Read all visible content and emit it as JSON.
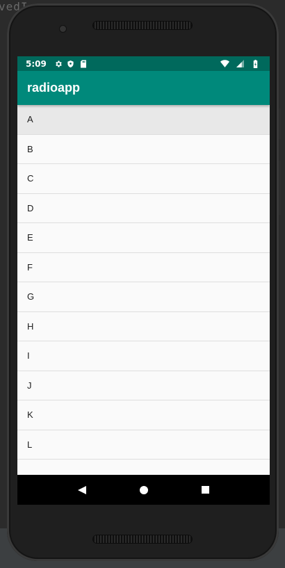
{
  "status_bar": {
    "time": "5:09",
    "icons_left": [
      "gear-icon",
      "shield-icon",
      "sd-card-icon"
    ],
    "icons_right": [
      "wifi-icon",
      "cell-signal-icon",
      "battery-icon"
    ]
  },
  "app_bar": {
    "title": "radioapp"
  },
  "list": {
    "items": [
      "A",
      "B",
      "C",
      "D",
      "E",
      "F",
      "G",
      "H",
      "I",
      "J",
      "K",
      "L"
    ],
    "selected_index": 0
  },
  "nav_bar": {
    "buttons": [
      "back-icon",
      "home-icon",
      "recents-icon"
    ]
  },
  "colors": {
    "status_bar": "#00695c",
    "app_bar": "#00897b",
    "list_background": "#fafafa",
    "selected_row": "#e8e8e8",
    "divider": "#dedede",
    "nav_bar": "#000000"
  }
}
